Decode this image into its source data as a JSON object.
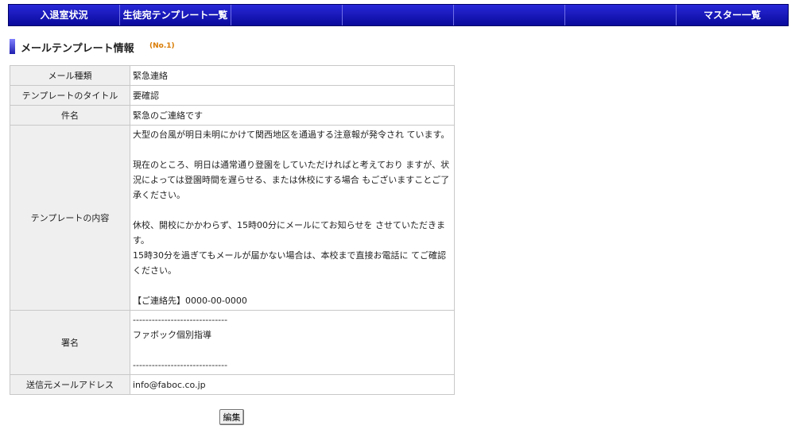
{
  "nav": {
    "items": [
      {
        "label": "入退室状況"
      },
      {
        "label": "生徒宛テンプレート一覧"
      },
      {
        "label": ""
      },
      {
        "label": ""
      },
      {
        "label": ""
      },
      {
        "label": ""
      },
      {
        "label": "マスター一覧"
      }
    ]
  },
  "section": {
    "title": "メールテンプレート情報",
    "number": "(No.1)"
  },
  "table": {
    "mail_type_label": "メール種類",
    "mail_type_value": "緊急連絡",
    "template_title_label": "テンプレートのタイトル",
    "template_title_value": "要確認",
    "subject_label": "件名",
    "subject_value": "緊急のご連絡です",
    "content_label": "テンプレートの内容",
    "content_paragraphs": [
      "大型の台風が明日未明にかけて関西地区を通過する注意報が発令され ています。",
      "",
      "現在のところ、明日は通常通り登園をしていただければと考えており ますが、状況によっては登園時間を遅らせる、または休校にする場合 もございますことご了承ください。",
      "",
      "休校、開校にかかわらず、15時00分にメールにてお知らせを させていただきます。",
      "15時30分を過ぎてもメールが届かない場合は、本校まで直接お電話に てご確認ください。",
      "",
      "【ご連絡先】0000-00-0000"
    ],
    "signature_label": "署名",
    "signature_lines": [
      "------------------------------",
      "ファボック個別指導",
      "",
      "------------------------------"
    ],
    "sender_label": "送信元メールアドレス",
    "sender_value": "info@faboc.co.jp"
  },
  "buttons": {
    "edit_label": "編集"
  },
  "colors": {
    "nav_background": "#1a1ac0",
    "label_background": "#efefef",
    "number_accent": "#d97a00"
  }
}
